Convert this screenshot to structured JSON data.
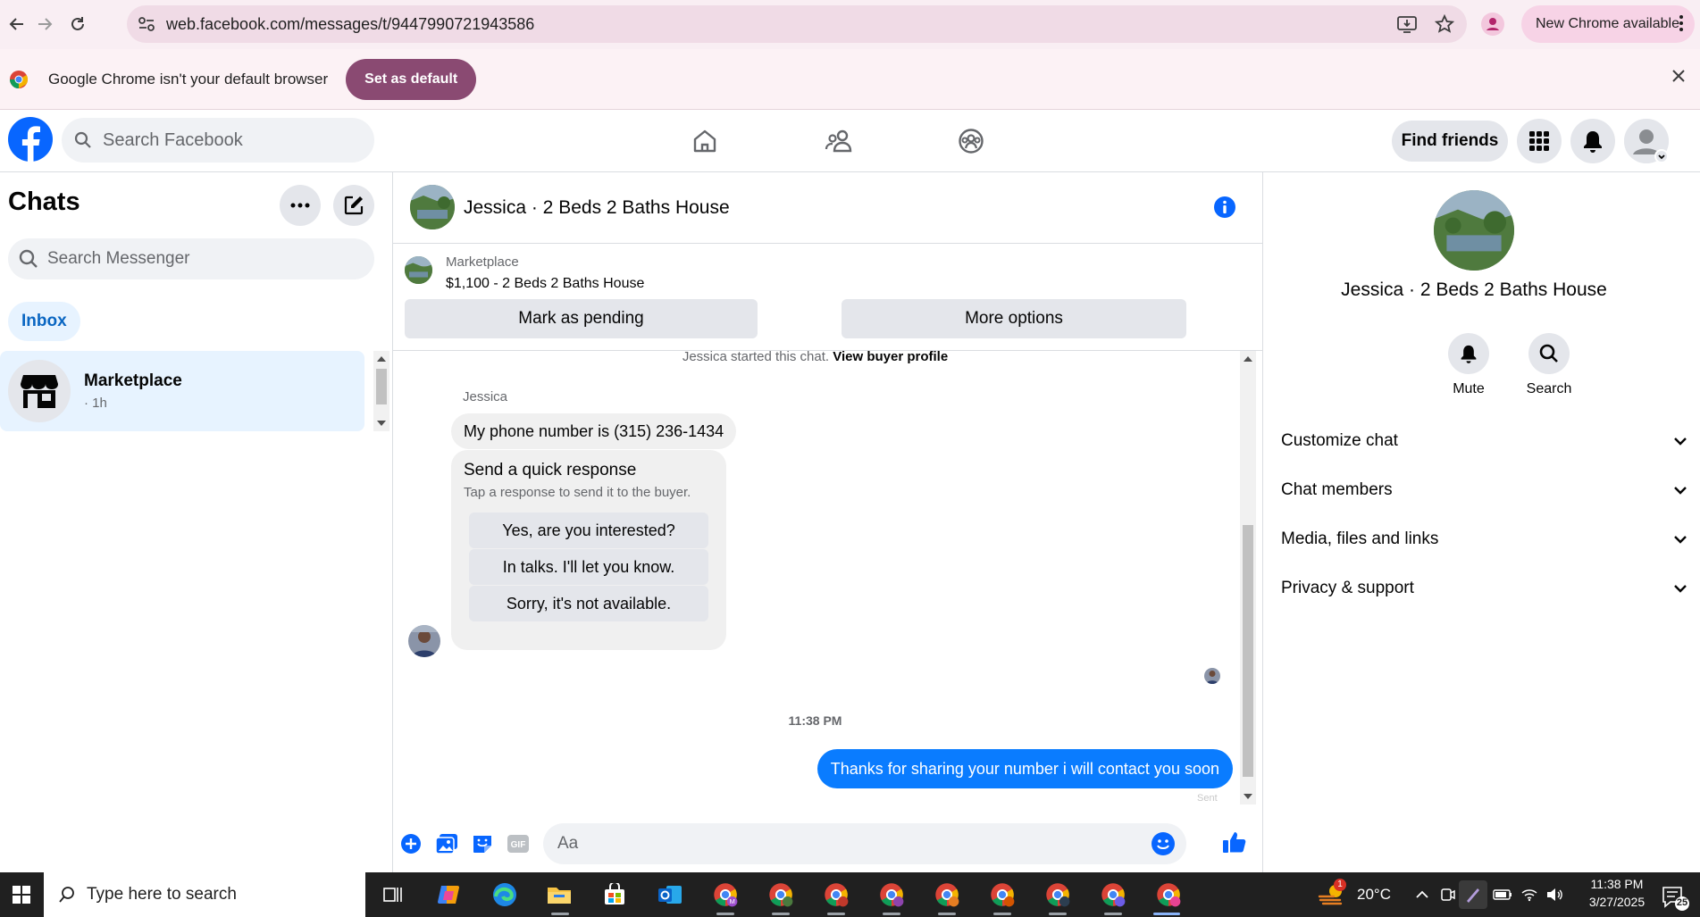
{
  "browser": {
    "url": "web.facebook.com/messages/t/9447990721943586",
    "new_chrome_label": "New Chrome available",
    "default_message": "Google Chrome isn't your default browser",
    "set_default_label": "Set as default"
  },
  "fb_header": {
    "search_placeholder": "Search Facebook",
    "find_friends_label": "Find friends"
  },
  "chats_panel": {
    "title": "Chats",
    "search_placeholder": "Search Messenger",
    "inbox_label": "Inbox",
    "conversations": [
      {
        "name": "Marketplace",
        "time": "· 1h"
      }
    ]
  },
  "chat": {
    "title": "Jessica · 2 Beds 2 Baths House",
    "marketplace_label": "Marketplace",
    "listing": "$1,100 - 2 Beds 2 Baths House",
    "mark_pending_label": "Mark as pending",
    "more_options_label": "More options",
    "started_text": "Jessica started this chat.",
    "view_profile_label": "View buyer profile",
    "sender_name": "Jessica",
    "incoming_message": "My phone number is (315) 236-1434",
    "quick_title": "Send a quick response",
    "quick_subtitle": "Tap a response to send it to the buyer.",
    "quick_responses": [
      "Yes, are you interested?",
      "In talks. I'll let you know.",
      "Sorry, it's not available."
    ],
    "timestamp": "11:38 PM",
    "outgoing_message": "Thanks for sharing your number i will contact you soon",
    "sent_label": "Sent",
    "composer_placeholder": "Aa"
  },
  "info_panel": {
    "name": "Jessica · 2 Beds 2 Baths House",
    "mute_label": "Mute",
    "search_label": "Search",
    "sections": [
      "Customize chat",
      "Chat members",
      "Media, files and links",
      "Privacy & support"
    ]
  },
  "taskbar": {
    "search_placeholder": "Type here to search",
    "temperature": "20°C",
    "weather_badge": "1",
    "time": "11:38 PM",
    "date": "3/27/2025",
    "notification_count": "25"
  },
  "colors": {
    "facebook_blue": "#0866ff",
    "outgoing_bubble": "#0a7cff",
    "set_default_button": "#8a4a72"
  }
}
